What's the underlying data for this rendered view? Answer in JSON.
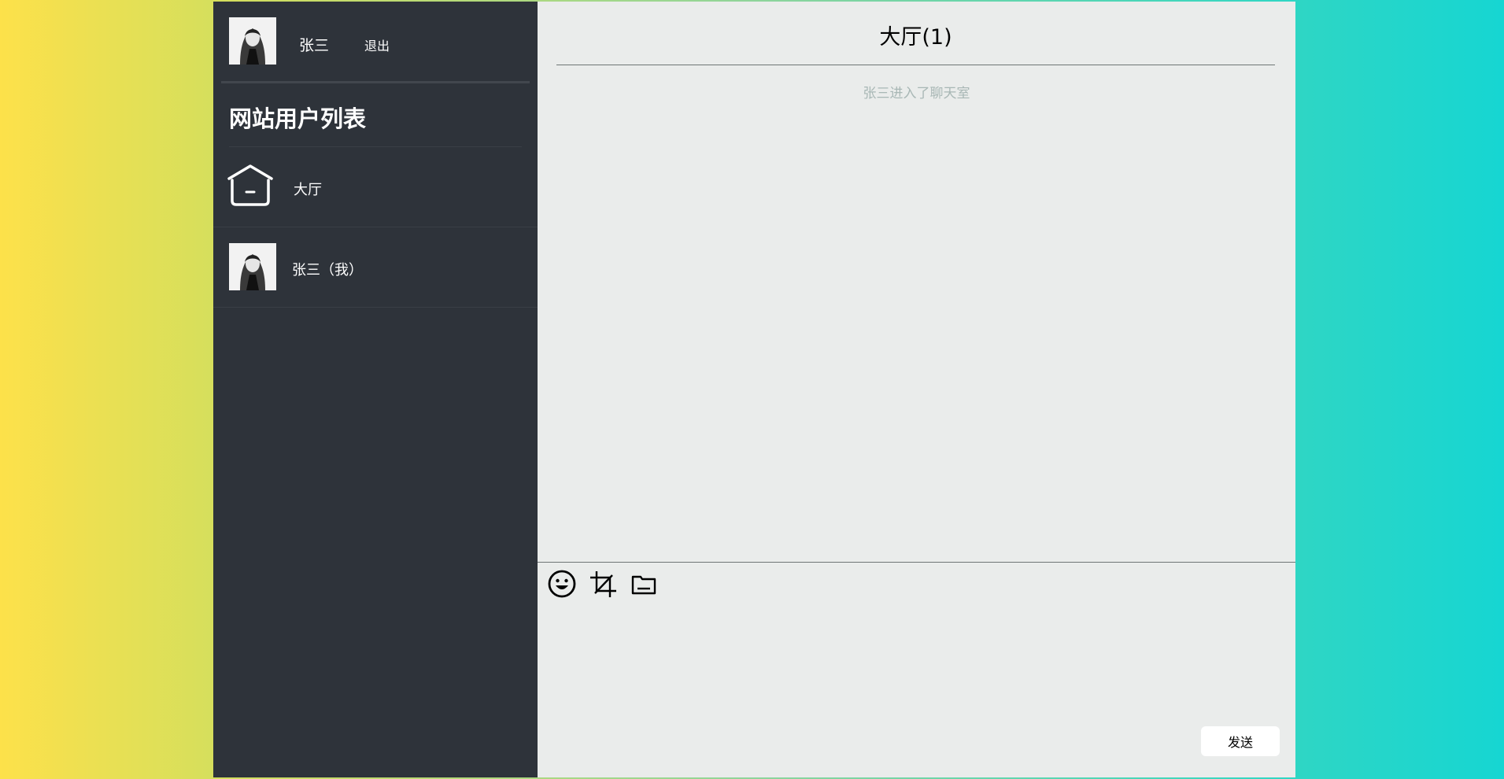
{
  "current_user": {
    "name": "张三",
    "logout_label": "退出",
    "avatar_icon": "user-avatar"
  },
  "sidebar": {
    "title": "网站用户列表",
    "items": [
      {
        "label": "大厅",
        "icon": "home-icon"
      },
      {
        "label": "张三（我）",
        "icon": "user-avatar"
      }
    ]
  },
  "chat": {
    "title": "大厅(1)",
    "system_messages": [
      "张三进入了聊天室"
    ]
  },
  "composer": {
    "tools": [
      "emoji-icon",
      "crop-icon",
      "folder-icon"
    ],
    "send_label": "发送"
  },
  "colors": {
    "sidebar_bg": "#2e333a",
    "chat_bg": "#eaeceb",
    "system_msg": "#a8b7b5"
  }
}
